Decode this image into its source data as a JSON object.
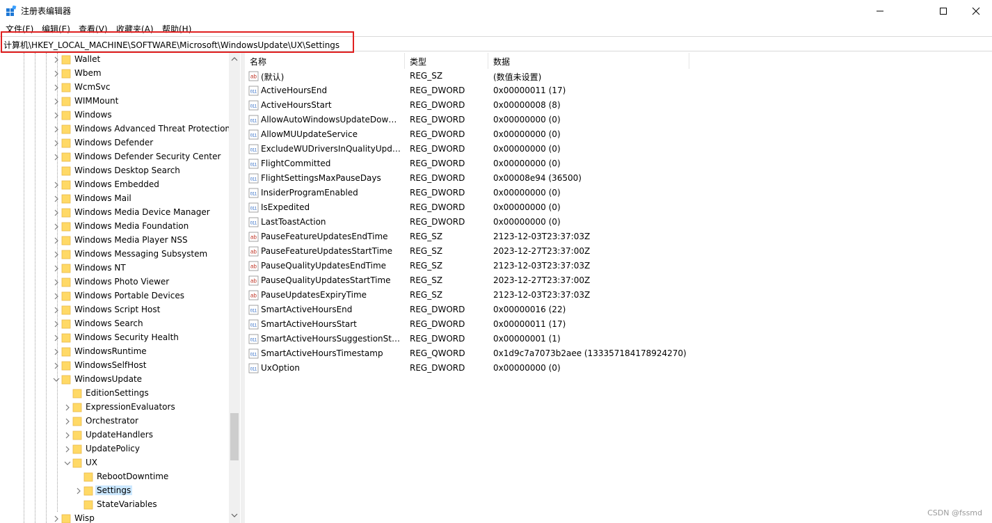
{
  "window": {
    "title": "注册表编辑器",
    "minimize_icon": "minimize-icon",
    "maximize_icon": "maximize-icon",
    "close_icon": "close-icon"
  },
  "menu": [
    "文件(F)",
    "编辑(E)",
    "查看(V)",
    "收藏夹(A)",
    "帮助(H)"
  ],
  "address": "计算机\\HKEY_LOCAL_MACHINE\\SOFTWARE\\Microsoft\\WindowsUpdate\\UX\\Settings",
  "colors": {
    "highlight_border": "#e02020",
    "selection": "#cce8ff",
    "folder": "#ffd966",
    "folder_dark": "#e8b84a"
  },
  "tree": [
    {
      "label": "Wallet",
      "level": 0,
      "expander": "collapsed"
    },
    {
      "label": "Wbem",
      "level": 0,
      "expander": "collapsed"
    },
    {
      "label": "WcmSvc",
      "level": 0,
      "expander": "collapsed"
    },
    {
      "label": "WIMMount",
      "level": 0,
      "expander": "collapsed"
    },
    {
      "label": "Windows",
      "level": 0,
      "expander": "collapsed"
    },
    {
      "label": "Windows Advanced Threat Protection",
      "level": 0,
      "expander": "collapsed"
    },
    {
      "label": "Windows Defender",
      "level": 0,
      "expander": "collapsed"
    },
    {
      "label": "Windows Defender Security Center",
      "level": 0,
      "expander": "collapsed"
    },
    {
      "label": "Windows Desktop Search",
      "level": 0,
      "expander": "none"
    },
    {
      "label": "Windows Embedded",
      "level": 0,
      "expander": "collapsed"
    },
    {
      "label": "Windows Mail",
      "level": 0,
      "expander": "collapsed"
    },
    {
      "label": "Windows Media Device Manager",
      "level": 0,
      "expander": "collapsed"
    },
    {
      "label": "Windows Media Foundation",
      "level": 0,
      "expander": "collapsed"
    },
    {
      "label": "Windows Media Player NSS",
      "level": 0,
      "expander": "collapsed"
    },
    {
      "label": "Windows Messaging Subsystem",
      "level": 0,
      "expander": "collapsed"
    },
    {
      "label": "Windows NT",
      "level": 0,
      "expander": "collapsed"
    },
    {
      "label": "Windows Photo Viewer",
      "level": 0,
      "expander": "collapsed"
    },
    {
      "label": "Windows Portable Devices",
      "level": 0,
      "expander": "collapsed"
    },
    {
      "label": "Windows Script Host",
      "level": 0,
      "expander": "collapsed"
    },
    {
      "label": "Windows Search",
      "level": 0,
      "expander": "collapsed"
    },
    {
      "label": "Windows Security Health",
      "level": 0,
      "expander": "collapsed"
    },
    {
      "label": "WindowsRuntime",
      "level": 0,
      "expander": "collapsed"
    },
    {
      "label": "WindowsSelfHost",
      "level": 0,
      "expander": "collapsed"
    },
    {
      "label": "WindowsUpdate",
      "level": 0,
      "expander": "expanded"
    },
    {
      "label": "EditionSettings",
      "level": 1,
      "expander": "none"
    },
    {
      "label": "ExpressionEvaluators",
      "level": 1,
      "expander": "collapsed"
    },
    {
      "label": "Orchestrator",
      "level": 1,
      "expander": "collapsed"
    },
    {
      "label": "UpdateHandlers",
      "level": 1,
      "expander": "collapsed"
    },
    {
      "label": "UpdatePolicy",
      "level": 1,
      "expander": "collapsed"
    },
    {
      "label": "UX",
      "level": 1,
      "expander": "expanded"
    },
    {
      "label": "RebootDowntime",
      "level": 2,
      "expander": "none"
    },
    {
      "label": "Settings",
      "level": 2,
      "expander": "collapsed",
      "selected": true
    },
    {
      "label": "StateVariables",
      "level": 2,
      "expander": "none"
    },
    {
      "label": "Wisp",
      "level": 0,
      "expander": "collapsed"
    }
  ],
  "list": {
    "headers": {
      "name": "名称",
      "type": "类型",
      "data": "数据"
    },
    "rows": [
      {
        "icon": "string-value-icon",
        "name": "(默认)",
        "type": "REG_SZ",
        "data": "(数值未设置)"
      },
      {
        "icon": "binary-value-icon",
        "name": "ActiveHoursEnd",
        "type": "REG_DWORD",
        "data": "0x00000011 (17)"
      },
      {
        "icon": "binary-value-icon",
        "name": "ActiveHoursStart",
        "type": "REG_DWORD",
        "data": "0x00000008 (8)"
      },
      {
        "icon": "binary-value-icon",
        "name": "AllowAutoWindowsUpdateDownl...",
        "type": "REG_DWORD",
        "data": "0x00000000 (0)"
      },
      {
        "icon": "binary-value-icon",
        "name": "AllowMUUpdateService",
        "type": "REG_DWORD",
        "data": "0x00000000 (0)"
      },
      {
        "icon": "binary-value-icon",
        "name": "ExcludeWUDriversInQualityUpdate",
        "type": "REG_DWORD",
        "data": "0x00000000 (0)"
      },
      {
        "icon": "binary-value-icon",
        "name": "FlightCommitted",
        "type": "REG_DWORD",
        "data": "0x00000000 (0)"
      },
      {
        "icon": "binary-value-icon",
        "name": "FlightSettingsMaxPauseDays",
        "type": "REG_DWORD",
        "data": "0x00008e94 (36500)"
      },
      {
        "icon": "binary-value-icon",
        "name": "InsiderProgramEnabled",
        "type": "REG_DWORD",
        "data": "0x00000000 (0)"
      },
      {
        "icon": "binary-value-icon",
        "name": "IsExpedited",
        "type": "REG_DWORD",
        "data": "0x00000000 (0)"
      },
      {
        "icon": "binary-value-icon",
        "name": "LastToastAction",
        "type": "REG_DWORD",
        "data": "0x00000000 (0)"
      },
      {
        "icon": "string-value-icon",
        "name": "PauseFeatureUpdatesEndTime",
        "type": "REG_SZ",
        "data": "2123-12-03T23:37:03Z"
      },
      {
        "icon": "string-value-icon",
        "name": "PauseFeatureUpdatesStartTime",
        "type": "REG_SZ",
        "data": "2023-12-27T23:37:00Z"
      },
      {
        "icon": "string-value-icon",
        "name": "PauseQualityUpdatesEndTime",
        "type": "REG_SZ",
        "data": "2123-12-03T23:37:03Z"
      },
      {
        "icon": "string-value-icon",
        "name": "PauseQualityUpdatesStartTime",
        "type": "REG_SZ",
        "data": "2023-12-27T23:37:00Z"
      },
      {
        "icon": "string-value-icon",
        "name": "PauseUpdatesExpiryTime",
        "type": "REG_SZ",
        "data": "2123-12-03T23:37:03Z"
      },
      {
        "icon": "binary-value-icon",
        "name": "SmartActiveHoursEnd",
        "type": "REG_DWORD",
        "data": "0x00000016 (22)"
      },
      {
        "icon": "binary-value-icon",
        "name": "SmartActiveHoursStart",
        "type": "REG_DWORD",
        "data": "0x00000011 (17)"
      },
      {
        "icon": "binary-value-icon",
        "name": "SmartActiveHoursSuggestionState",
        "type": "REG_DWORD",
        "data": "0x00000001 (1)"
      },
      {
        "icon": "binary-value-icon",
        "name": "SmartActiveHoursTimestamp",
        "type": "REG_QWORD",
        "data": "0x1d9c7a7073b2aee (133357184178924270)"
      },
      {
        "icon": "binary-value-icon",
        "name": "UxOption",
        "type": "REG_DWORD",
        "data": "0x00000000 (0)"
      }
    ]
  },
  "watermark": "CSDN @fssmd"
}
